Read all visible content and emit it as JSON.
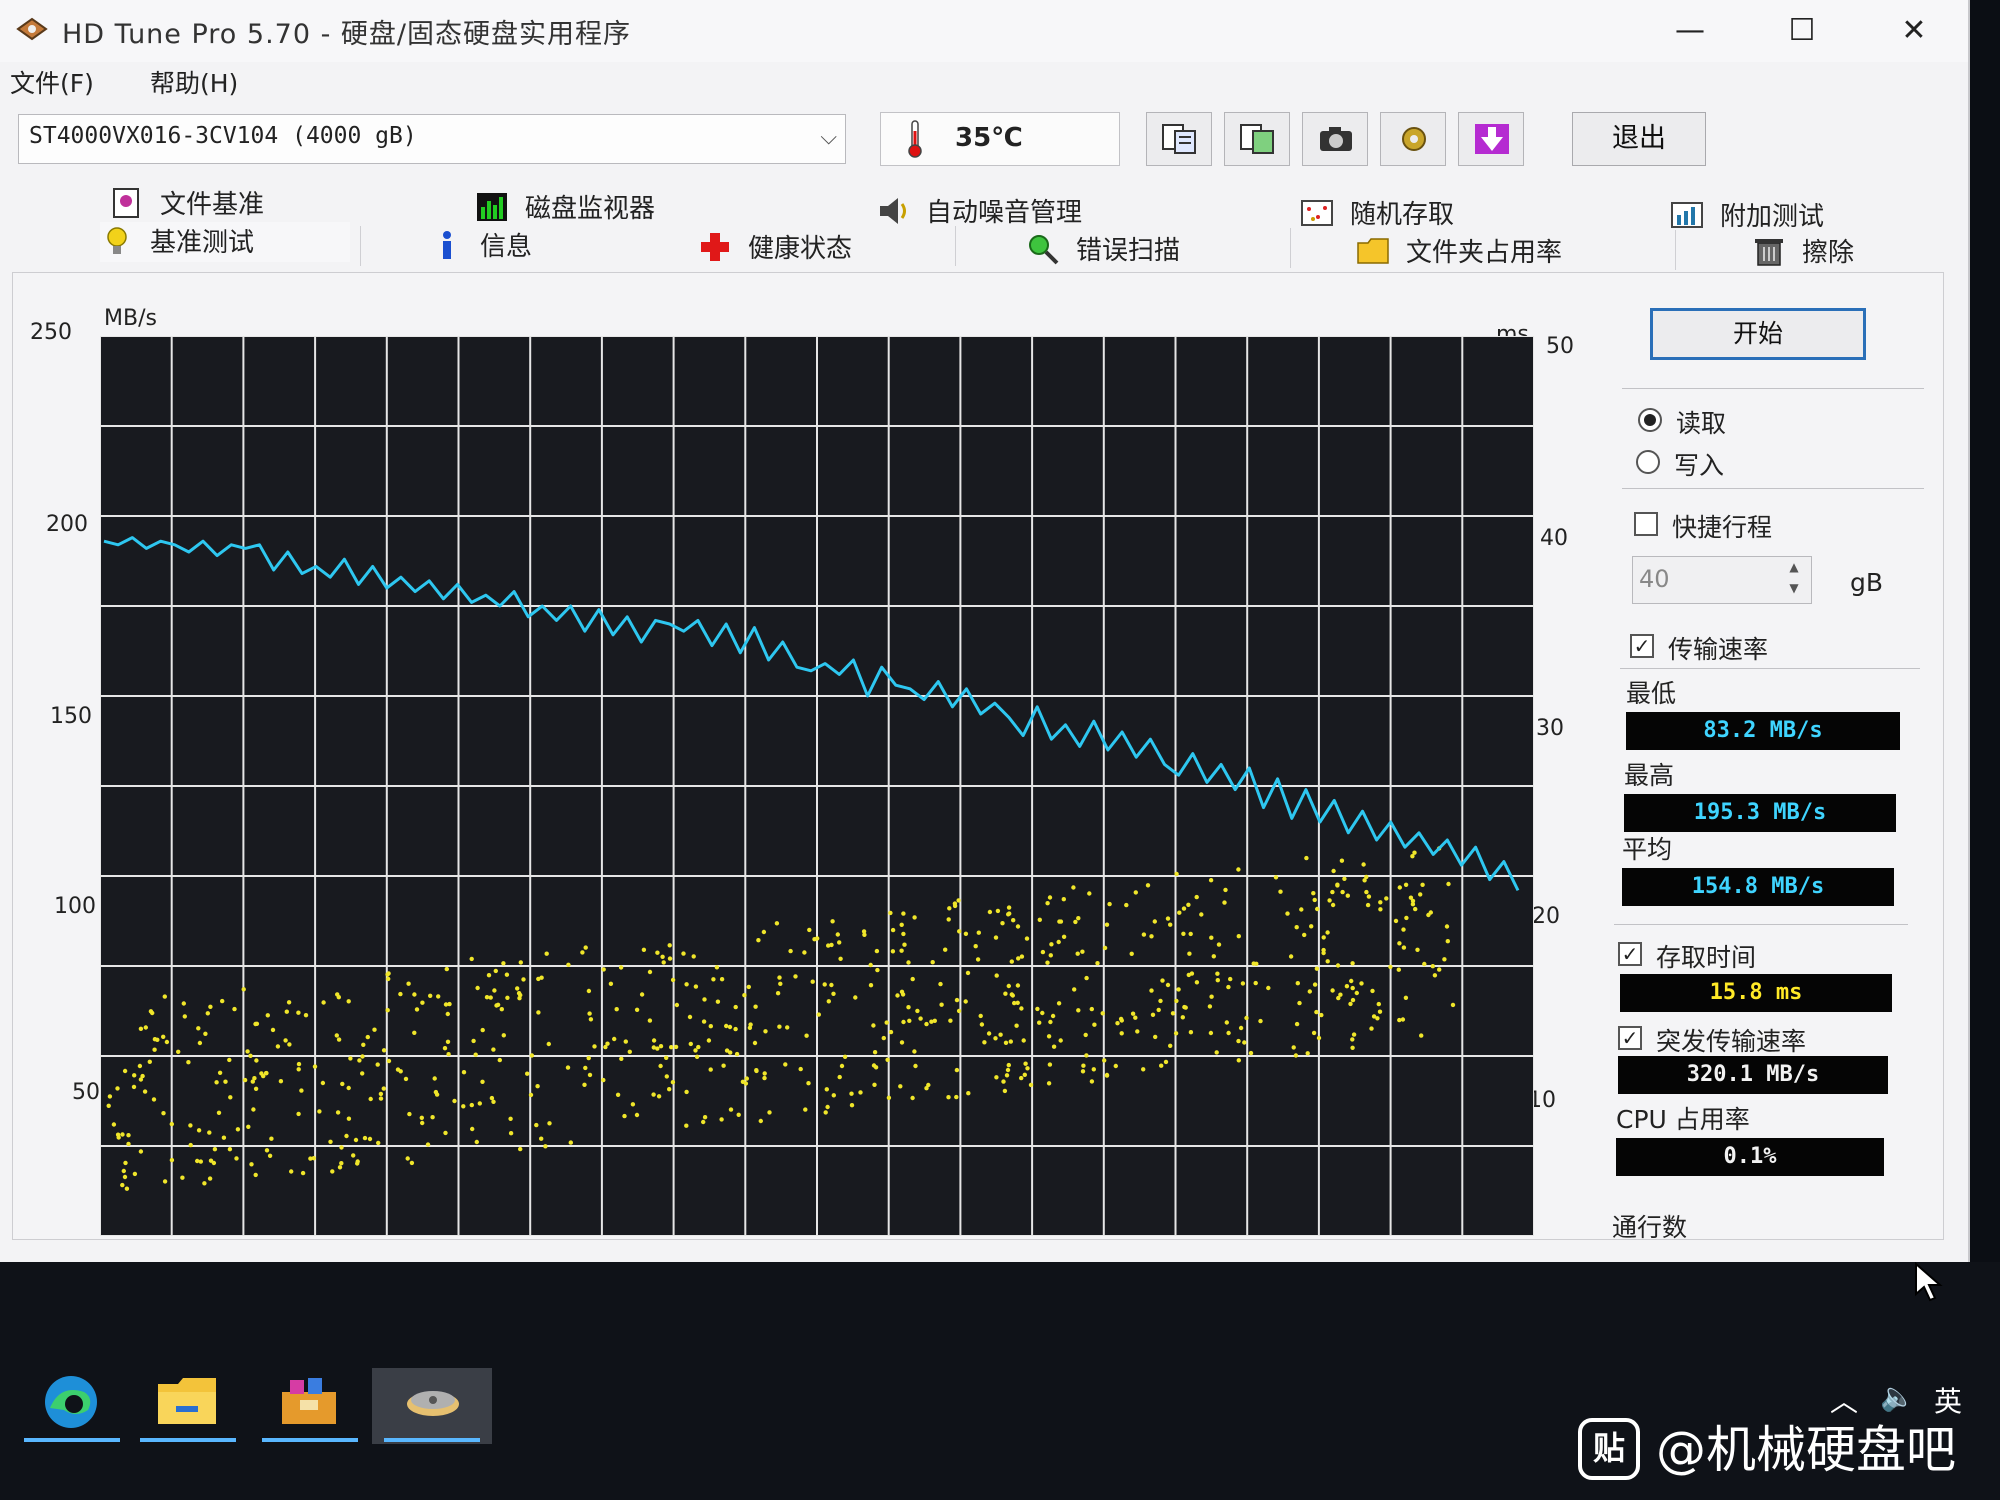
{
  "window": {
    "title": "HD Tune Pro 5.70 - 硬盘/固态硬盘实用程序",
    "controls": {
      "minimize": "—",
      "maximize": "☐",
      "close": "✕"
    }
  },
  "menu": [
    {
      "label": "文件(F)"
    },
    {
      "label": "帮助(H)"
    }
  ],
  "toolbar": {
    "drive": "ST4000VX016-3CV104 (4000 gB)",
    "temperature": "35℃",
    "exit_label": "退出",
    "buttons": [
      "copy-text-icon",
      "copy-screenshot-icon",
      "camera-icon",
      "settings-icon",
      "download-icon"
    ]
  },
  "tabs": {
    "row1": [
      {
        "label": "文件基准",
        "icon": "file-benchmark-icon"
      },
      {
        "label": "磁盘监视器",
        "icon": "disk-monitor-icon"
      },
      {
        "label": "自动噪音管理",
        "icon": "speaker-icon"
      },
      {
        "label": "随机存取",
        "icon": "random-access-icon"
      },
      {
        "label": "附加测试",
        "icon": "extra-tests-icon"
      }
    ],
    "row2": [
      {
        "label": "基准测试",
        "icon": "bulb-icon",
        "active": true
      },
      {
        "label": "信息",
        "icon": "info-icon"
      },
      {
        "label": "健康状态",
        "icon": "health-cross-icon"
      },
      {
        "label": "错误扫描",
        "icon": "magnifier-icon"
      },
      {
        "label": "文件夹占用率",
        "icon": "folder-icon"
      },
      {
        "label": "擦除",
        "icon": "trash-icon"
      }
    ]
  },
  "controls": {
    "start_label": "开始",
    "read_label": "读取",
    "write_label": "写入",
    "mode": "read",
    "short_stroke_label": "快捷行程",
    "short_stroke_checked": false,
    "short_stroke_value": "40",
    "short_stroke_unit": "gB",
    "transfer_rate_label": "传输速率",
    "transfer_rate_checked": true,
    "min_label": "最低",
    "min_value": "83.2 MB/s",
    "max_label": "最高",
    "max_value": "195.3 MB/s",
    "avg_label": "平均",
    "avg_value": "154.8 MB/s",
    "access_time_label": "存取时间",
    "access_time_checked": true,
    "access_time_value": "15.8 ms",
    "burst_label": "突发传输速率",
    "burst_checked": true,
    "burst_value": "320.1 MB/s",
    "cpu_label": "CPU 占用率",
    "cpu_value": "0.1%",
    "passes_label": "通行数"
  },
  "chart_data": {
    "type": "line",
    "title": "",
    "ylabel_left": "MB/s",
    "ylabel_right": "ms",
    "ylim_left": [
      0,
      250
    ],
    "ylim_right": [
      0,
      50
    ],
    "yticks_left": [
      "250",
      "200",
      "150",
      "100",
      "50"
    ],
    "yticks_right": [
      "50",
      "40",
      "30",
      "20",
      "10"
    ],
    "grid": true,
    "series": [
      {
        "color": "#2ec7f0",
        "x": [
          0,
          1,
          2,
          3,
          4,
          5,
          6,
          7,
          8,
          9,
          10,
          11,
          12,
          13,
          14,
          15,
          16,
          17,
          18,
          19,
          20,
          21,
          22,
          23,
          24,
          25,
          26,
          27,
          28,
          29,
          30,
          31,
          32,
          33,
          34,
          35,
          36,
          37,
          38,
          39,
          40,
          41,
          42,
          43,
          44,
          45,
          46,
          47,
          48,
          49,
          50,
          51,
          52,
          53,
          54,
          55,
          56,
          57,
          58,
          59,
          60,
          61,
          62,
          63,
          64,
          65,
          66,
          67,
          68,
          69,
          70,
          71,
          72,
          73,
          74,
          75,
          76,
          77,
          78,
          79,
          80,
          81,
          82,
          83,
          84,
          85,
          86,
          87,
          88,
          89,
          90,
          91,
          92,
          93,
          94,
          95,
          96,
          97,
          98,
          99,
          100
        ],
        "values": [
          193,
          192,
          194,
          191,
          193,
          192,
          190,
          193,
          189,
          192,
          191,
          192,
          185,
          190,
          184,
          186,
          183,
          188,
          181,
          186,
          180,
          183,
          179,
          182,
          177,
          181,
          176,
          178,
          175,
          179,
          172,
          175,
          171,
          175,
          168,
          174,
          167,
          172,
          165,
          171,
          170,
          168,
          171,
          164,
          170,
          162,
          169,
          160,
          165,
          158,
          157,
          159,
          156,
          160,
          150,
          158,
          153,
          152,
          149,
          154,
          147,
          152,
          145,
          148,
          144,
          139,
          147,
          138,
          142,
          136,
          143,
          135,
          140,
          133,
          138,
          131,
          128,
          134,
          126,
          131,
          124,
          130,
          119,
          127,
          116,
          124,
          115,
          121,
          112,
          118,
          110,
          115,
          108,
          112,
          106,
          110,
          103,
          108,
          99,
          104,
          96
        ]
      },
      {
        "type": "scatter",
        "color": "#f0e62a",
        "note": "access time points, cloud between ~10 and ~22 ms"
      }
    ]
  }
}
